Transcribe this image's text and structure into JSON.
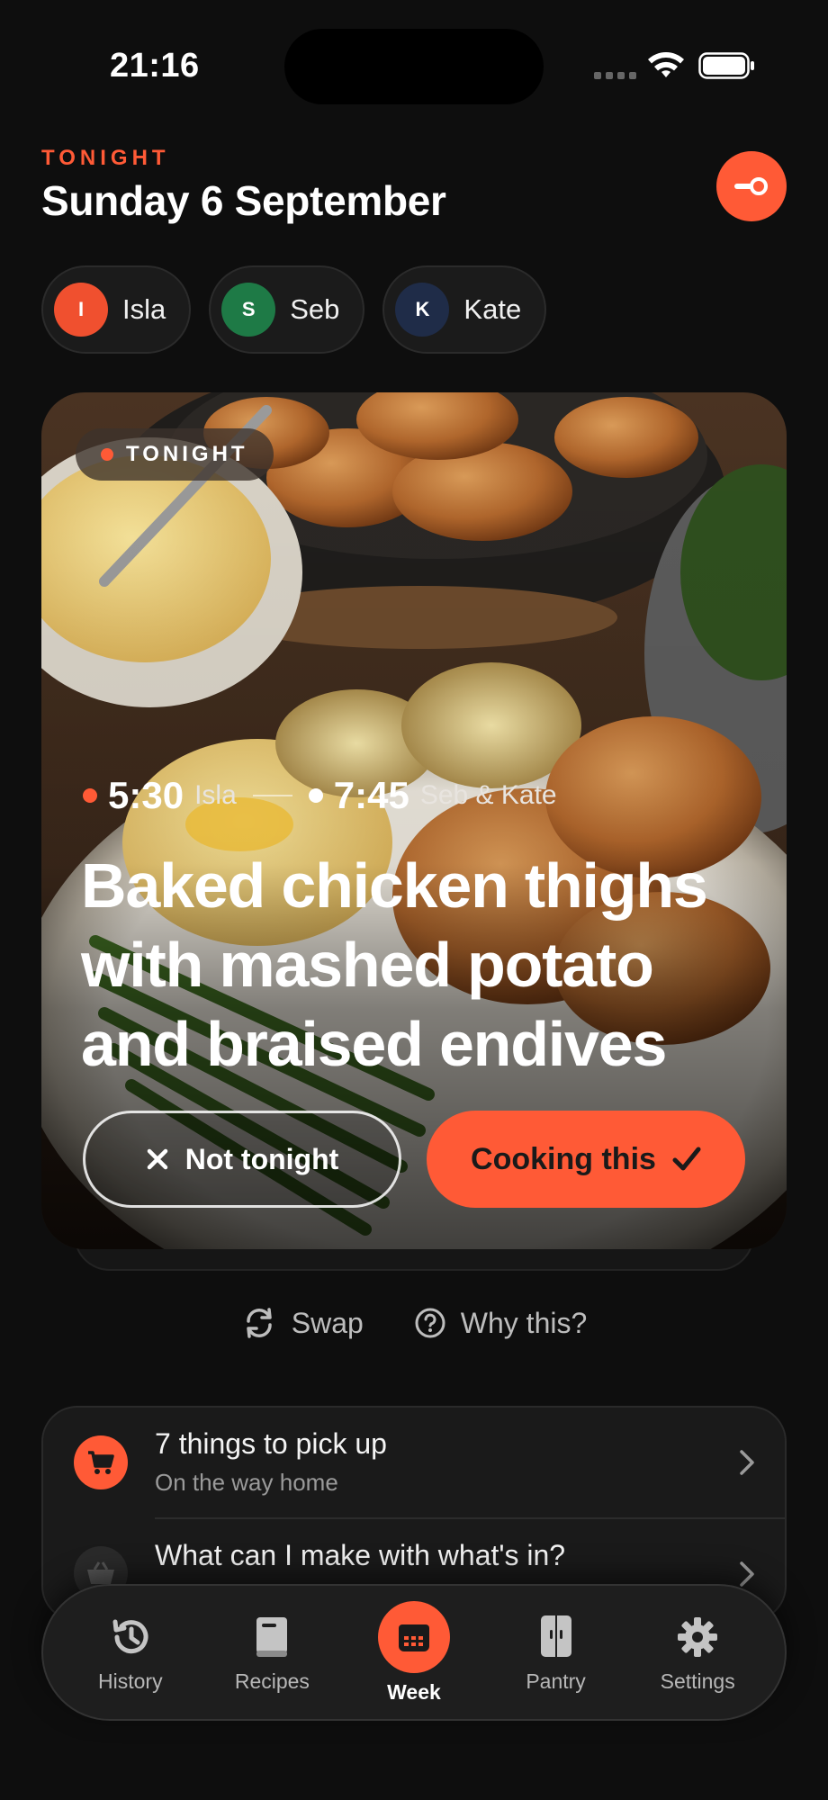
{
  "status_bar": {
    "time": "21:16"
  },
  "header": {
    "eyebrow": "TONIGHT",
    "title": "Sunday 6 September"
  },
  "people": [
    {
      "initial": "I",
      "name": "Isla",
      "color": "#f0502f"
    },
    {
      "initial": "S",
      "name": "Seb",
      "color": "#1e7a46"
    },
    {
      "initial": "K",
      "name": "Kate",
      "color": "#1f2c48"
    }
  ],
  "hero": {
    "badge": "TONIGHT",
    "slots": [
      {
        "time": "5:30",
        "who": "Isla",
        "dot_color": "#ff5a36"
      },
      {
        "time": "7:45",
        "who": "Seb & Kate",
        "dot_color": "#ffffff"
      }
    ],
    "dish": "Baked chicken thighs with mashed potato and braised endives",
    "skip_label": "Not tonight",
    "cook_label": "Cooking this"
  },
  "secondary": {
    "swap_label": "Swap",
    "why_label": "Why this?"
  },
  "list": [
    {
      "title": "7 things to pick up",
      "subtitle": "On the way home",
      "icon": "cart-icon"
    },
    {
      "title": "What can I make with what's in?",
      "icon": "basket-icon"
    }
  ],
  "tabs": [
    {
      "label": "History",
      "icon": "history-icon",
      "active": false
    },
    {
      "label": "Recipes",
      "icon": "book-icon",
      "active": false
    },
    {
      "label": "Week",
      "icon": "calendar-icon",
      "active": true
    },
    {
      "label": "Pantry",
      "icon": "pantry-icon",
      "active": false
    },
    {
      "label": "Settings",
      "icon": "gear-icon",
      "active": false
    }
  ],
  "colors": {
    "accent": "#ff5a36",
    "background": "#0e0e0e"
  }
}
